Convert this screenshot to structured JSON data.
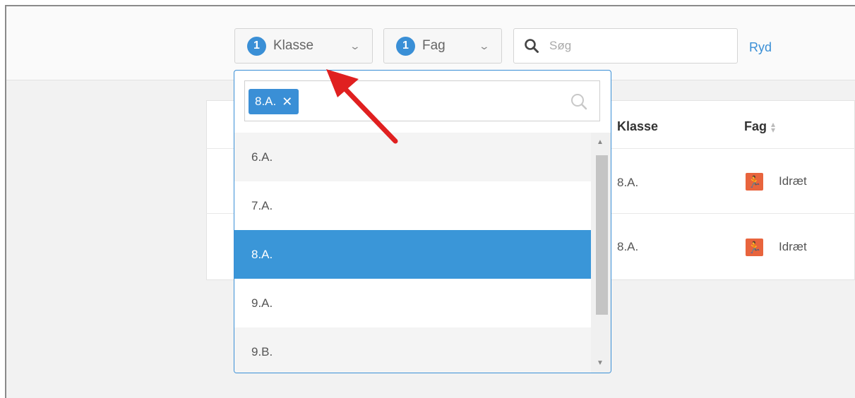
{
  "toolbar": {
    "klasse_filter": {
      "badge": "1",
      "label": "Klasse"
    },
    "fag_filter": {
      "badge": "1",
      "label": "Fag"
    },
    "search": {
      "placeholder": "Søg"
    },
    "clear_label": "Ryd"
  },
  "table": {
    "columns": [
      "Klasse",
      "Fag"
    ],
    "rows": [
      {
        "klasse": "8.A.",
        "fag": "Idræt"
      },
      {
        "klasse": "8.A.",
        "fag": "Idræt"
      }
    ]
  },
  "dropdown": {
    "selected_tag": "8.A.",
    "tag_remove_glyph": "✕",
    "items": [
      "6.A.",
      "7.A.",
      "8.A.",
      "9.A.",
      "9.B."
    ],
    "selected_index": 2
  },
  "colors": {
    "accent": "#3a8fd6",
    "selected_row": "#3a96d8",
    "sport_icon_bg": "#e8643d",
    "annotation_arrow": "#e02020"
  },
  "icons": {
    "filter_chevron": "chevron-down-icon",
    "search": "search-icon",
    "sport": "running-person-icon",
    "sort": "sort-icon"
  }
}
